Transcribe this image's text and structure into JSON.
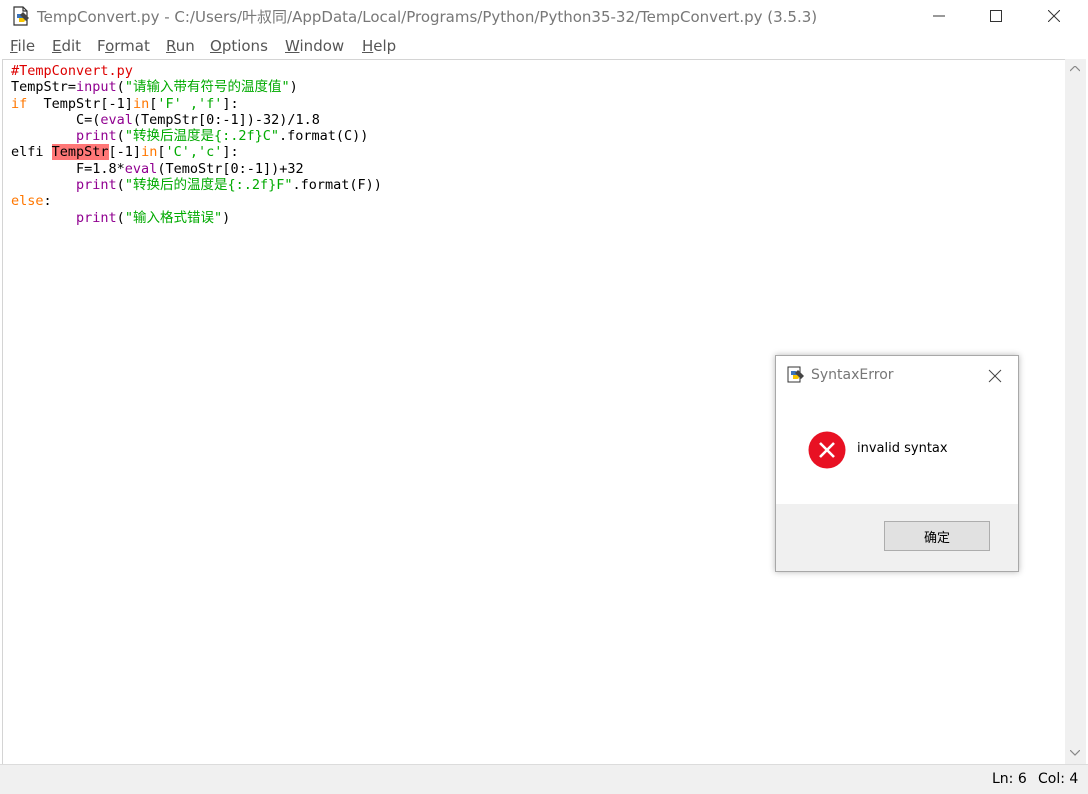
{
  "window": {
    "title": "TempConvert.py - C:/Users/叶叔同/AppData/Local/Programs/Python/Python35-32/TempConvert.py (3.5.3)"
  },
  "menu": {
    "file": {
      "first": "F",
      "rest": "ile"
    },
    "edit": {
      "first": "E",
      "rest": "dit"
    },
    "format": {
      "pre": "F",
      "u": "o",
      "rest": "rmat"
    },
    "run": {
      "first": "R",
      "rest": "un"
    },
    "options": {
      "first": "O",
      "rest": "ptions"
    },
    "window": {
      "first": "W",
      "rest": "indow"
    },
    "help": {
      "first": "H",
      "rest": "elp"
    }
  },
  "code": {
    "l1_comment": "#TempConvert.py",
    "l2_a": "TempStr=",
    "l2_fn": "input",
    "l2_b": "(",
    "l2_str": "\"请输入带有符号的温度值\"",
    "l2_c": ")",
    "l3_kw": "if",
    "l3_a": "  TempStr[-1]",
    "l3_in": "in",
    "l3_b": "[",
    "l3_str": "'F' ,'f'",
    "l3_c": "]:",
    "l4_ind": "        C=(",
    "l4_fn": "eval",
    "l4_rest": "(TempStr[0:-1])-32)/1.8",
    "l5_ind": "        ",
    "l5_fn": "print",
    "l5_b": "(",
    "l5_str": "\"转换后温度是{:.2f}C\"",
    "l5_rest": ".format(C))",
    "l6_a": "elfi ",
    "l6_err": "TempStr",
    "l6_b": "[-1]",
    "l6_in": "in",
    "l6_c": "[",
    "l6_str": "'C','c'",
    "l6_d": "]:",
    "l7_ind": "        F=1.8*",
    "l7_fn": "eval",
    "l7_rest": "(TemoStr[0:-1])+32",
    "l8_ind": "        ",
    "l8_fn": "print",
    "l8_b": "(",
    "l8_str": "\"转换后的温度是{:.2f}F\"",
    "l8_rest": ".format(F))",
    "l9_kw": "else",
    "l9_rest": ":",
    "l10_ind": "        ",
    "l10_fn": "print",
    "l10_b": "(",
    "l10_str": "\"输入格式错误\"",
    "l10_c": ")"
  },
  "status": {
    "line": "Ln: 6",
    "col": "Col: 4"
  },
  "dialog": {
    "title": "SyntaxError",
    "message": "invalid syntax",
    "ok_label": "确定"
  },
  "colors": {
    "keyword": "#ff7700",
    "builtin": "#900090",
    "string": "#00aa00",
    "comment": "#dd0000",
    "error_highlight": "#ff7777",
    "error_icon": "#e81123"
  }
}
